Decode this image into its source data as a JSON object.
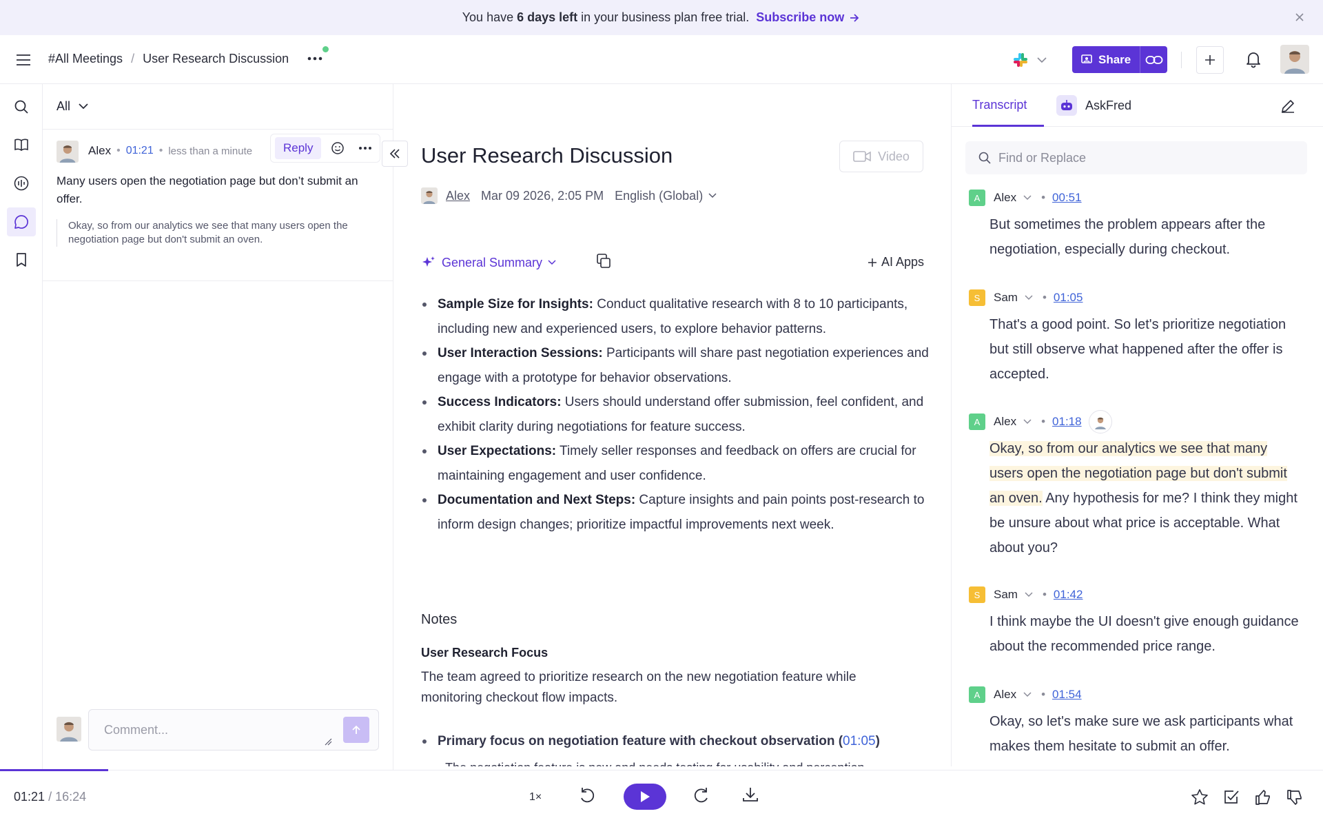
{
  "banner": {
    "pre": "You have",
    "bold": "6 days left",
    "post": "in your business plan free trial.",
    "cta": "Subscribe now"
  },
  "header": {
    "crumbs": [
      "#All Meetings",
      "User Research Discussion"
    ],
    "share_label": "Share"
  },
  "comments": {
    "filter": "All",
    "item": {
      "author": "Alex",
      "time": "01:21",
      "relative": "less than a minute",
      "reply_label": "Reply",
      "text": "Many users open the negotiation page but don’t submit an offer.",
      "quote": "Okay, so from our analytics we see that many users open the negotiation page but don't submit an oven."
    },
    "input_placeholder": "Comment..."
  },
  "meeting": {
    "title": "User Research Discussion",
    "video_label": "Video",
    "owner": "Alex",
    "date": "Mar 09 2026, 2:05 PM",
    "language": "English (Global)",
    "summary_type": "General Summary",
    "ai_apps": "AI Apps",
    "bullets": [
      {
        "title": "Sample Size for Insights:",
        "text": " Conduct qualitative research with 8 to 10 participants, including new and experienced users, to explore behavior patterns."
      },
      {
        "title": "User Interaction Sessions:",
        "text": " Participants will share past negotiation experiences and engage with a prototype for behavior observations."
      },
      {
        "title": "Success Indicators:",
        "text": " Users should understand offer submission, feel confident, and exhibit clarity during negotiations for feature success."
      },
      {
        "title": "User Expectations:",
        "text": " Timely seller responses and feedback on offers are crucial for maintaining engagement and user confidence."
      },
      {
        "title": "Documentation and Next Steps:",
        "text": " Capture insights and pain points post-research to inform design changes; prioritize impactful improvements next week."
      }
    ],
    "notes_heading": "Notes",
    "focus_heading": "User Research Focus",
    "focus_text": "The team agreed to prioritize research on the new negotiation feature while monitoring checkout flow impacts.",
    "focus_bullet": "Primary focus on negotiation feature with checkout observation",
    "focus_bullet_ts": "01:05",
    "cut_text": "The negotiation feature is new and needs testing for usability and perception."
  },
  "transcript": {
    "tab_transcript": "Transcript",
    "tab_askfred": "AskFred",
    "search_placeholder": "Find or Replace",
    "segments": [
      {
        "initial": "A",
        "speaker": "Alex",
        "ts": "00:51",
        "text": "But sometimes the problem appears after the negotiation, especially during checkout."
      },
      {
        "initial": "S",
        "speaker": "Sam",
        "ts": "01:05",
        "text": "That's a good point. So let's prioritize negotiation but still observe what happened after the offer is accepted."
      },
      {
        "initial": "A",
        "speaker": "Alex",
        "ts": "01:18",
        "highlight": "Okay, so from our analytics we see that many users open the negotiation page but don't submit an oven.",
        "text": " Any hypothesis for me? I think they might be unsure about what price is acceptable. What about you?"
      },
      {
        "initial": "S",
        "speaker": "Sam",
        "ts": "01:42",
        "text": "I think maybe the UI doesn't give enough guidance about the recommended price range."
      },
      {
        "initial": "A",
        "speaker": "Alex",
        "ts": "01:54",
        "text": "Okay, so let's make sure we ask participants what makes them hesitate to submit an offer."
      }
    ]
  },
  "player": {
    "current": "01:21",
    "separator": "/",
    "duration": "16:24",
    "speed": "1×",
    "progress_fraction": 0.082
  },
  "colors": {
    "accent": "#5b34d6",
    "link": "#3f63d8",
    "alex_badge": "#5fd08a",
    "sam_badge": "#f6be35",
    "highlight": "#fdf5df"
  }
}
